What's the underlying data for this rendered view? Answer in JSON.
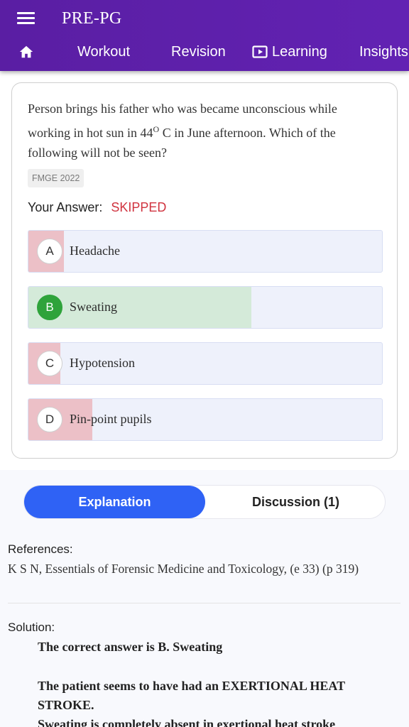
{
  "app": {
    "title": "PRE-PG"
  },
  "icons": {
    "menu": "menu-icon",
    "home": "home-icon",
    "learning": "play-screen-icon"
  },
  "nav": {
    "workout": "Workout",
    "revision": "Revision",
    "learning": "Learning",
    "insights": "Insights"
  },
  "question": {
    "text_before": "Person brings his father who was became unconscious while working in hot sun in 44",
    "superscript": "O",
    "text_after": " C in June afternoon. Which of the following will not be seen?",
    "tag": "FMGE 2022",
    "your_answer_label": "Your Answer:",
    "your_answer_value": "SKIPPED"
  },
  "colors": {
    "accent": "#2f62f5",
    "correct": "#2fa33b",
    "correct_fill": "#d4ead9",
    "wrong_fill": "#ecc0c7",
    "status": "#d0333f",
    "header": "#5b1fa6"
  },
  "options": [
    {
      "letter": "A",
      "text": "Headache",
      "fill_fraction": 0.1,
      "correct": false
    },
    {
      "letter": "B",
      "text": "Sweating",
      "fill_fraction": 0.63,
      "correct": true
    },
    {
      "letter": "C",
      "text": "Hypotension",
      "fill_fraction": 0.09,
      "correct": false
    },
    {
      "letter": "D",
      "text": "Pin-point pupils",
      "fill_fraction": 0.18,
      "correct": false
    }
  ],
  "tabs": {
    "explanation": "Explanation",
    "discussion": "Discussion (1)"
  },
  "references": {
    "label": "References:",
    "text": "K S N, Essentials of Forensic Medicine and Toxicology, (e 33) (p 319)"
  },
  "solution": {
    "label": "Solution:",
    "lines": [
      "The correct answer is B. Sweating",
      "The patient seems to have had an EXERTIONAL HEAT STROKE.",
      "Sweating is completely absent in exertional heat stroke"
    ]
  }
}
